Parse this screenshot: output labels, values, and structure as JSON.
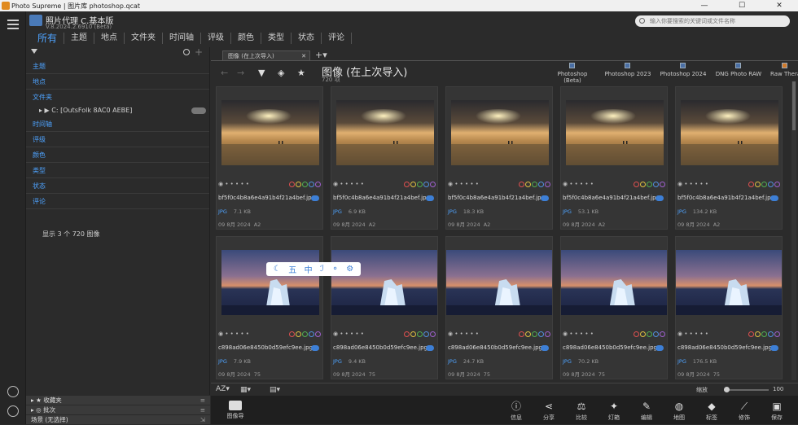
{
  "window": {
    "title": "Photo Supreme | 图片库 photoshop.qcat",
    "controls": [
      "—",
      "☐",
      "✕"
    ]
  },
  "app": {
    "name": "照片代理 C.基本版",
    "version": "V.8.2024.2.6910 (Beta)",
    "search_placeholder": "输入你要搜索的关键词或文件名称"
  },
  "nav": {
    "tabs": [
      "所有",
      "主题",
      "地点",
      "文件夹",
      "时间轴",
      "评级",
      "颜色",
      "类型",
      "状态",
      "评论"
    ],
    "active_index": 0
  },
  "sidebar": {
    "items": [
      "主题",
      "地点",
      "文件夹",
      "时间轴",
      "评级",
      "颜色",
      "类型",
      "状态",
      "评论"
    ],
    "folder_entry": "C: [OutsFolk 8AC0 AEBE]",
    "status": "显示 3 个 720 图像",
    "bottom": [
      "收藏夹",
      "批次",
      "场景 (无选择)"
    ]
  },
  "document": {
    "tab_label": "图像 (在上次导入)",
    "view_title": "图像 (在上次导入)",
    "view_count": "720 项"
  },
  "external_apps": [
    "Photoshop (Beta)",
    "Photoshop 2023",
    "Photoshop 2024",
    "DNG Photo RAW",
    "Raw Therapee"
  ],
  "cards": [
    {
      "name": "bf5f0c4b8a6e4a91b4f21a4bef.jpg",
      "type": "JPG",
      "size": "7.1 KB",
      "date": "09 8月 2024",
      "res": "A2",
      "scene": "sunset"
    },
    {
      "name": "bf5f0c4b8a6e4a91b4f21a4bef.jpg",
      "type": "JPG",
      "size": "6.9 KB",
      "date": "09 8月 2024",
      "res": "A2",
      "scene": "sunset"
    },
    {
      "name": "bf5f0c4b8a6e4a91b4f21a4bef.jpg",
      "type": "JPG",
      "size": "18.3 KB",
      "date": "09 8月 2024",
      "res": "A2",
      "scene": "sunset"
    },
    {
      "name": "bf5f0c4b8a6e4a91b4f21a4bef.jpg",
      "type": "JPG",
      "size": "53.1 KB",
      "date": "09 8月 2024",
      "res": "A2",
      "scene": "sunset"
    },
    {
      "name": "bf5f0c4b8a6e4a91b4f21a4bef.jpg",
      "type": "JPG",
      "size": "134.2 KB",
      "date": "09 8月 2024",
      "res": "A2",
      "scene": "sunset"
    },
    {
      "name": "c898ad06e8450b0d59efc9ee.jpg",
      "type": "JPG",
      "size": "7.9 KB",
      "date": "09 8月 2024",
      "res": "75",
      "scene": "ice"
    },
    {
      "name": "c898ad06e8450b0d59efc9ee.jpg",
      "type": "JPG",
      "size": "9.4 KB",
      "date": "09 8月 2024",
      "res": "75",
      "scene": "ice"
    },
    {
      "name": "c898ad06e8450b0d59efc9ee.jpg",
      "type": "JPG",
      "size": "24.7 KB",
      "date": "09 8月 2024",
      "res": "75",
      "scene": "ice"
    },
    {
      "name": "c898ad06e8450b0d59efc9ee.jpg",
      "type": "JPG",
      "size": "70.2 KB",
      "date": "09 8月 2024",
      "res": "75",
      "scene": "ice"
    },
    {
      "name": "c898ad06e8450b0d59efc9ee.jpg",
      "type": "JPG",
      "size": "176.5 KB",
      "date": "09 8月 2024",
      "res": "75",
      "scene": "ice"
    }
  ],
  "floating_toolbar": [
    "☾",
    "五",
    "中",
    "ℐ",
    "⚬",
    "⚙"
  ],
  "statusbar": {
    "sort": "AZ▾",
    "zoom_label": "缩放",
    "zoom_value": "100"
  },
  "importer_label": "图像导",
  "actions": [
    "信息",
    "分享",
    "比较",
    "灯箱",
    "编辑",
    "地图",
    "标签",
    "修饰",
    "保存"
  ],
  "colors": {
    "accent": "#4ea3ff",
    "toggle": "#3d7fd6"
  }
}
